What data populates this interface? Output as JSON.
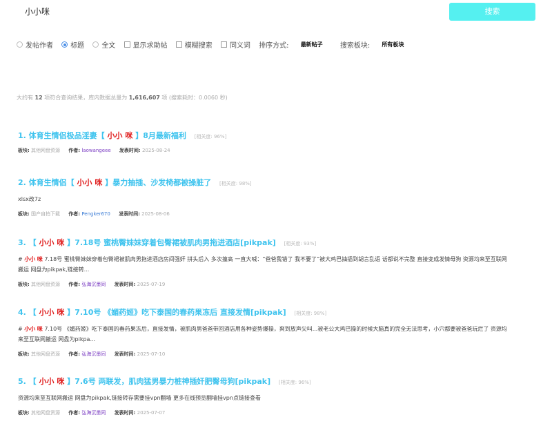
{
  "search": {
    "query": "小小咪",
    "button_label": "搜索"
  },
  "options": {
    "author": "发帖作者",
    "title": "标题",
    "fulltext": "全文",
    "show_help": "显示求助帖",
    "fuzzy": "模糊搜索",
    "synonym": "同义词",
    "sort_label": "排序方式:",
    "sort_value": "最新帖子",
    "scope_label": "搜索板块:",
    "scope_value": "所有板块",
    "selected": "title"
  },
  "stats": {
    "prefix": "大约有",
    "count": "12",
    "mid": "项符合查询结果，库内数据总量为",
    "total": "1,616,607",
    "suffix": "项 (搜索耗时：0.0060 秒)"
  },
  "meta_labels": {
    "board": "板块:",
    "author": "作者:",
    "time": "发表时间:"
  },
  "results": [
    {
      "title_pre": "1. 体育生情侣极品淫妻【",
      "kw1": "小小",
      "kw2": "咪",
      "title_post": "】8月最新福利",
      "similarity": "[相关度: 96%]",
      "snippet": null,
      "board": "其他网盘资源",
      "author": "laowangeee",
      "author_color": "purple",
      "time": "2025-08-24"
    },
    {
      "title_pre": "2. 体育生情侣【",
      "kw1": "小小",
      "kw2": "咪",
      "title_post": "】暴力抽插、沙发椅都被操脏了",
      "similarity": "[相关度: 98%]",
      "snippet": {
        "text": "xlsx改7z"
      },
      "board": "国产自拍下载",
      "author": "Pengker670",
      "author_color": "blue",
      "time": "2025-08-06"
    },
    {
      "title_pre": "3. 【",
      "kw1": "小小",
      "kw2": "咪",
      "title_post": "】7.18号 蜜桃臀妹妹穿着包臀裙被肌肉男拖进酒店[pikpak]",
      "similarity": "[相关度: 93%]",
      "snippet": {
        "lead": "#",
        "kw1": "小小",
        "kw2": "咪",
        "text": " 7.18号 蜜桃臀妹妹穿着包臀裙被肌肉男拖进酒店房间强奸 拼头后入 多次撞高 一直大喊：“爸爸我错了 我不要了”被大鸡巴抽插到胡言乱语 话都说不完整 直接变成发情母狗 资源均来至互联网搬运 网盘为pikpak,链接转..."
      },
      "board": "其他网盘资源",
      "author": "弘海沉墨同",
      "author_color": "purple",
      "time": "2025-07-19"
    },
    {
      "title_pre": "4. 【",
      "kw1": "小小",
      "kw2": "咪",
      "title_post": "】7.10号 《媚药姬》吃下泰国的春药果冻后 直接发情[pikpak]",
      "similarity": "[相关度: 98%]",
      "snippet": {
        "lead": "#",
        "kw1": "小小",
        "kw2": "咪",
        "text": " 7.10号 《媚药姬》吃下泰国的春药果冻后，直接发情，被肌肉男爸爸带回酒店用各种姿势爆操，爽到放声尖叫...被老公大鸡巴操的时候大脑真的完全无法思考，小穴都要被爸爸玩烂了 资源均来至互联网搬运 网盘为pikpa..."
      },
      "board": "其他网盘资源",
      "author": "弘海沉墨同",
      "author_color": "purple",
      "time": "2025-07-10"
    },
    {
      "title_pre": "5. 【",
      "kw1": "小小",
      "kw2": "咪",
      "title_post": "】7.6号 两联发，肌肉猛男暴力桩神插奸肥臀母狗[pikpak]",
      "similarity": "[相关度: 96%]",
      "snippet": {
        "text": "资源均来至互联网搬运 网盘为pikpak,链接转存需要挂vpn翻墙 更多在线预览翻墙挂vpn点链接查看"
      },
      "board": "其他网盘资源",
      "author": "弘海沉墨同",
      "author_color": "purple",
      "time": "2025-07-07"
    }
  ]
}
